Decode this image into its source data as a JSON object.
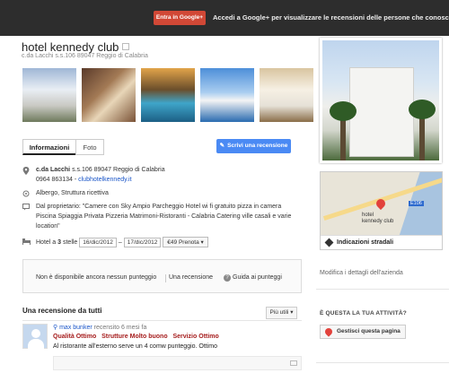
{
  "topbar": {
    "signin_label": "Entra in Google+",
    "promo_text": "Accedi a Google+ per visualizzare le recensioni delle persone che conosci."
  },
  "place": {
    "name": "hotel kennedy club",
    "address_line": "c.da Lacchi s.s.106 89047 Reggio di Calabria",
    "address_bold": "c.da Lacchi",
    "address_rest": " s.s.106 89047 Reggio di Calabria",
    "phone": "0964 863134",
    "website_sep": " - ",
    "website": "clubhotelkennedy.it",
    "category": "Albergo, Struttura ricettiva",
    "owner_label": "Dal proprietario:",
    "owner_text_1": " \"Camere con Sky Ampio Parcheggio Hotel wi fi gratuito pizza in camera",
    "owner_text_2": "Piscina Spiaggia Privata Pizzeria Matrimoni-Ristoranti - Calabria Catering ville casali e varie",
    "owner_text_3": "location\""
  },
  "tabs": {
    "info": "Informazioni",
    "photo": "Foto"
  },
  "write_review_label": "Scrivi una recensione",
  "booking": {
    "stars_prefix": "Hotel a ",
    "stars_value": "3",
    "stars_suffix": " stelle",
    "checkin": "16/dic/2012",
    "dash": "–",
    "checkout": "17/dic/2012",
    "price": "€49 Prenota"
  },
  "score_box": {
    "no_score": "Non è disponibile ancora nessun punteggio",
    "one_review": "Una recensione",
    "guide": "Guida ai punteggi"
  },
  "reviews": {
    "title": "Una recensione da tutti",
    "sort_label": "Più utili",
    "items": [
      {
        "author": "max bunker",
        "meta": "recensito 6 mesi fa",
        "ratings": [
          {
            "label": "Qualità",
            "value": "Ottimo"
          },
          {
            "label": "Strutture",
            "value": "Molto buono"
          },
          {
            "label": "Servizio",
            "value": "Ottimo"
          }
        ],
        "text": "Al ristorante all'esterno serve un 4 comw punteggio. Ottimo"
      }
    ]
  },
  "map": {
    "marker_label_1": "hotel",
    "marker_label_2": "kennedy club",
    "road_shield": "E106",
    "directions": "Indicazioni stradali"
  },
  "sidebar": {
    "edit_details": "Modifica i dettagli dell'azienda",
    "business_question": "È QUESTA LA TUA ATTIVITÀ?",
    "manage_page": "Gestisci questa pagina"
  },
  "colors": {
    "topbar": "#2d2d2d",
    "google_red": "#d14836",
    "blue_button": "#4a8af4",
    "link": "#1a55c8",
    "rating_red": "#a51c1c"
  }
}
